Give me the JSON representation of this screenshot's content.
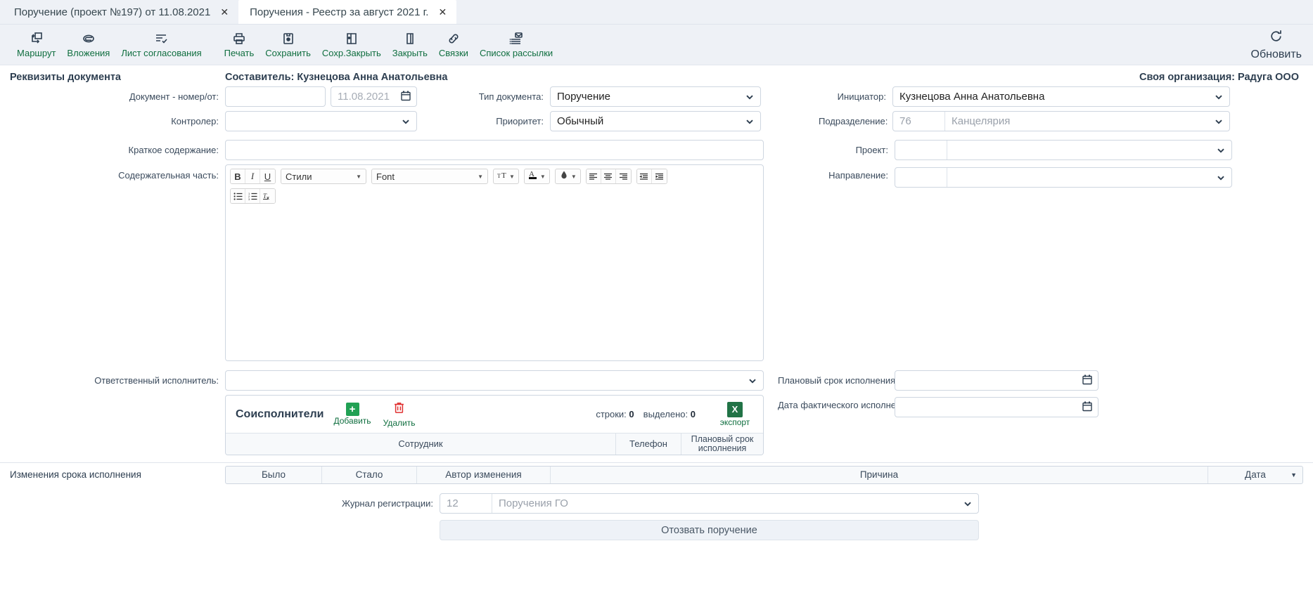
{
  "tabs": [
    {
      "label": "Поручение (проект №197) от 11.08.2021",
      "close": "✕",
      "active": false
    },
    {
      "label": "Поручения - Реестр за август 2021 г.",
      "close": "✕",
      "active": true
    }
  ],
  "toolbar": {
    "items": [
      {
        "label": "Маршрут",
        "icon": "route-icon"
      },
      {
        "label": "Вложения",
        "icon": "attachment-icon"
      },
      {
        "label": "Лист согласования",
        "icon": "approval-sheet-icon"
      },
      {
        "label": "Печать",
        "icon": "print-icon"
      },
      {
        "label": "Сохранить",
        "icon": "save-icon"
      },
      {
        "label": "Сохр.Закрыть",
        "icon": "save-close-icon"
      },
      {
        "label": "Закрыть",
        "icon": "close-door-icon"
      },
      {
        "label": "Связки",
        "icon": "link-icon"
      },
      {
        "label": "Список рассылки",
        "icon": "mailing-list-icon"
      }
    ],
    "refresh": {
      "label": "Обновить",
      "icon": "refresh-icon"
    }
  },
  "header": {
    "section_title": "Реквизиты документа",
    "author": "Составитель: Кузнецова Анна Анатольевна",
    "organization": "Своя организация: Радуга ООО"
  },
  "form": {
    "doc_number_label": "Документ - номер/от:",
    "doc_number_value": "",
    "doc_date_value": "11.08.2021",
    "controller_label": "Контролер:",
    "controller_value": "",
    "doc_type_label": "Тип документа:",
    "doc_type_value": "Поручение",
    "priority_label": "Приоритет:",
    "priority_value": "Обычный",
    "initiator_label": "Инициатор:",
    "initiator_value": "Кузнецова Анна Анатольевна",
    "department_label": "Подразделение:",
    "department_code": "76",
    "department_value": "Канцелярия",
    "summary_label": "Краткое содержание:",
    "summary_value": "",
    "content_label": "Содержательная часть:",
    "project_label": "Проект:",
    "project_code": "",
    "project_value": "",
    "direction_label": "Направление:",
    "direction_code": "",
    "direction_value": ""
  },
  "editor": {
    "bold": "B",
    "italic": "I",
    "underline": "U",
    "styles_value": "Стили",
    "font_value": "Font",
    "size_icon": "text-size-icon",
    "color_icon": "text-color-icon",
    "highlight_icon": "highlight-color-icon",
    "align_left": "align-left-icon",
    "align_center": "align-center-icon",
    "align_right": "align-right-icon",
    "outdent": "outdent-icon",
    "indent": "indent-icon",
    "bullet_list": "bullet-list-icon",
    "numbered_list": "numbered-list-icon",
    "clear_format": "clear-format-icon",
    "arrow": "▼"
  },
  "executor": {
    "responsible_label": "Ответственный исполнитель:",
    "responsible_value": "",
    "planned_date_label": "Плановый срок исполнения:",
    "planned_date_value": "",
    "actual_date_label": "Дата фактического исполнения:",
    "actual_date_value": ""
  },
  "coexec": {
    "title": "Соисполнители",
    "add_label": "Добавить",
    "add_glyph": "+",
    "delete_label": "Удалить",
    "delete_glyph": "🗑",
    "rows_label": "строки:",
    "rows_value": "0",
    "selected_label": "выделено:",
    "selected_value": "0",
    "export_label": "экспорт",
    "export_glyph": "X",
    "columns": [
      "Сотрудник",
      "Телефон",
      "Плановый срок исполнения"
    ],
    "rows": []
  },
  "changelog": {
    "title": "Изменения срока исполнения",
    "columns": [
      "Было",
      "Стало",
      "Автор изменения",
      "Причина",
      "Дата"
    ],
    "sort_caret": "▼",
    "rows": []
  },
  "footer": {
    "journal_label": "Журнал регистрации:",
    "journal_code": "12",
    "journal_value": "Поручения ГО",
    "recall_button": "Отозвать поручение"
  },
  "colors": {
    "accent_green": "#0f6e3f",
    "add_green": "#21a154",
    "delete_red": "#e03131",
    "excel_green": "#217346",
    "text_dark": "#2d3e50",
    "tabbar_bg": "#eef1f6"
  }
}
